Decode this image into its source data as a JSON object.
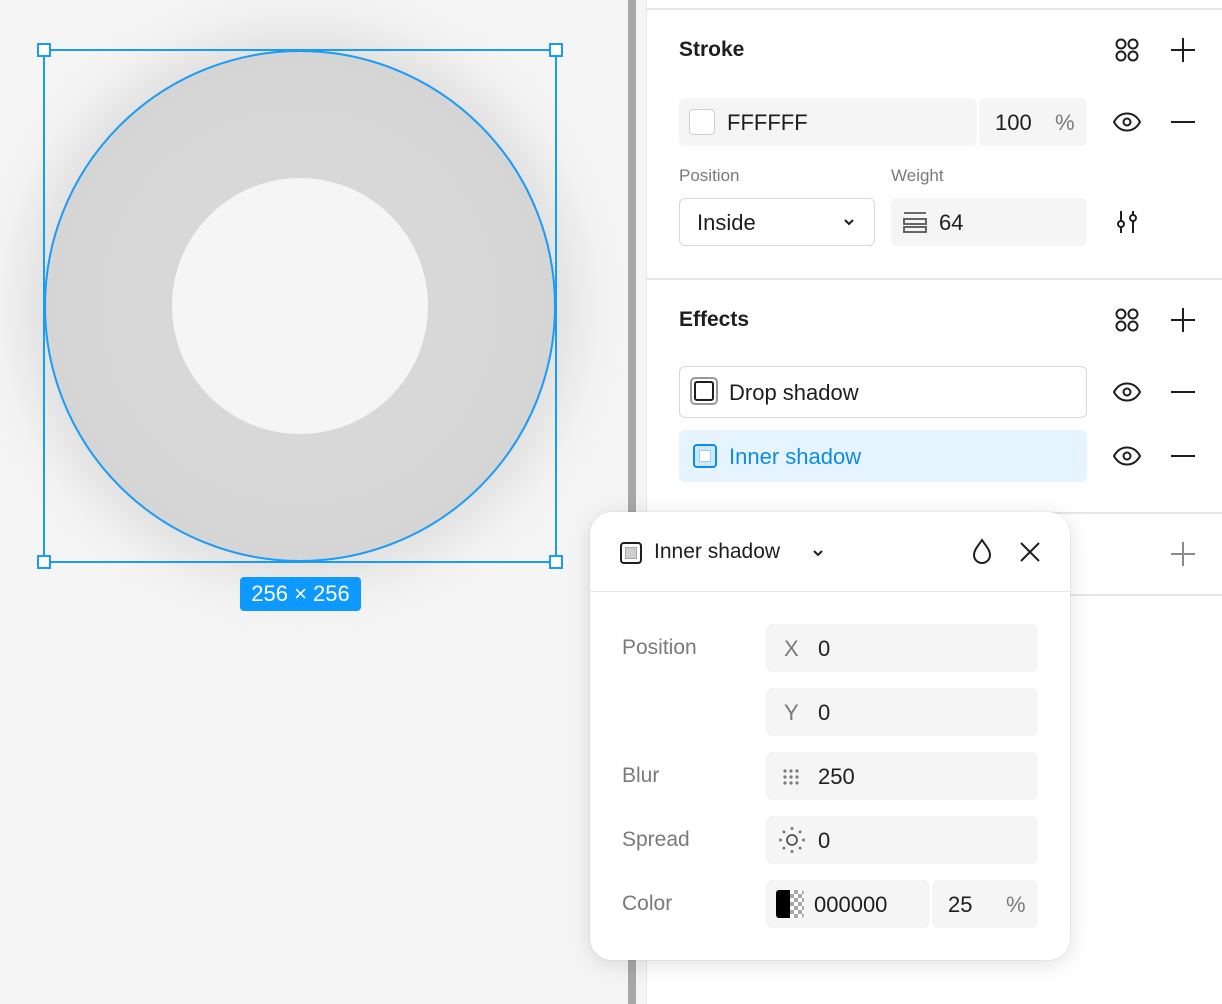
{
  "canvas": {
    "dimensions_badge": "256 × 256"
  },
  "stroke": {
    "title": "Stroke",
    "color_hex": "FFFFFF",
    "opacity": "100",
    "percent": "%",
    "position_label": "Position",
    "position_value": "Inside",
    "weight_label": "Weight",
    "weight_value": "64"
  },
  "effects": {
    "title": "Effects",
    "items": [
      {
        "label": "Drop shadow"
      },
      {
        "label": "Inner shadow"
      }
    ]
  },
  "popup": {
    "title": "Inner shadow",
    "position_label": "Position",
    "x_label": "X",
    "x_value": "0",
    "y_label": "Y",
    "y_value": "0",
    "blur_label": "Blur",
    "blur_value": "250",
    "spread_label": "Spread",
    "spread_value": "0",
    "color_label": "Color",
    "color_hex": "000000",
    "color_opacity": "25",
    "percent": "%"
  },
  "colors": {
    "selection": "#1a9cf5",
    "badge": "#0d99ff",
    "selected_row_bg": "#e5f4ff",
    "selected_row_text": "#0c8ce9"
  },
  "icons": [
    "styles-grid-icon",
    "plus-icon",
    "eye-icon",
    "minus-icon",
    "chevron-down-icon",
    "weight-lines-icon",
    "sliders-icon",
    "drop-icon",
    "close-icon",
    "blur-dots-icon",
    "spread-sun-icon",
    "checker-swatch-icon"
  ]
}
